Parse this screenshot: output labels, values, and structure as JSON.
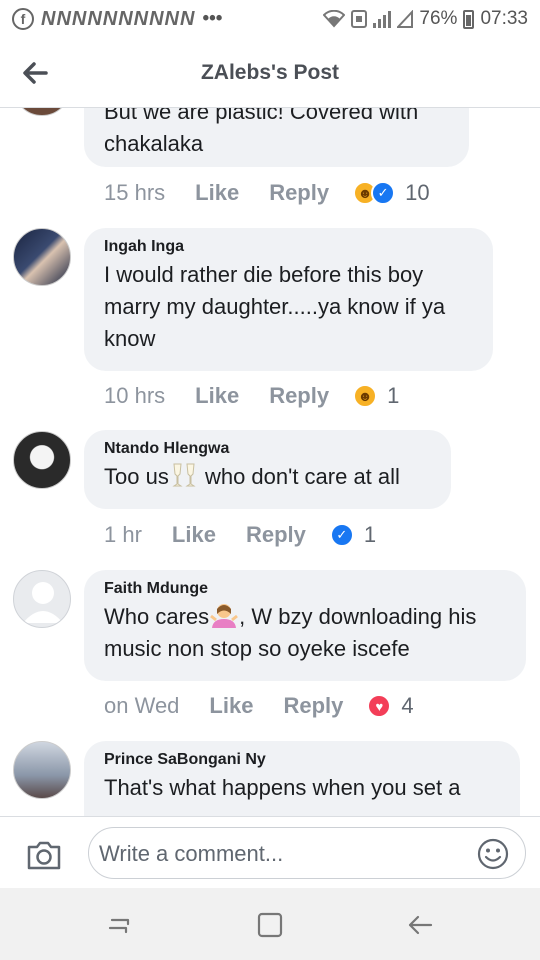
{
  "status_bar": {
    "notifications": "NNNNNNNNNN",
    "more": "•••",
    "battery": "76%",
    "time": "07:33"
  },
  "header": {
    "title": "ZAlebs's Post"
  },
  "comments": [
    {
      "author": "",
      "text": "But we are plastic! Covered with chakalaka",
      "time": "15 hrs",
      "like": "Like",
      "reply": "Reply",
      "reactions": [
        "haha",
        "like"
      ],
      "count": "10"
    },
    {
      "author": "Ingah Inga",
      "text": "I would rather die before this boy marry my daughter.....ya know if ya know",
      "time": "10 hrs",
      "like": "Like",
      "reply": "Reply",
      "reactions": [
        "haha"
      ],
      "count": "1"
    },
    {
      "author": "Ntando Hlengwa",
      "text_before": "Too us",
      "text_after": " who don't care at all",
      "emoji": "clinking-glasses",
      "time": "1 hr",
      "like": "Like",
      "reply": "Reply",
      "reactions": [
        "like"
      ],
      "count": "1"
    },
    {
      "author": "Faith Mdunge",
      "text_before": "Who cares",
      "text_after": ", W bzy downloading his music non stop so oyeke iscefe",
      "emoji": "person-shrugging",
      "time": "on Wed",
      "like": "Like",
      "reply": "Reply",
      "reactions": [
        "love"
      ],
      "count": "4"
    },
    {
      "author": "Prince SaBongani Ny",
      "text": "That's what happens when you set a",
      "time": "",
      "like": "",
      "reply": "",
      "reactions": [],
      "count": ""
    }
  ],
  "composer": {
    "placeholder": "Write a comment..."
  },
  "colors": {
    "like_blue": "#1877f2",
    "love_red": "#f33e58",
    "haha_yellow": "#f7b125",
    "bubble_bg": "#f0f2f5",
    "meta_grey": "#8d949e"
  }
}
